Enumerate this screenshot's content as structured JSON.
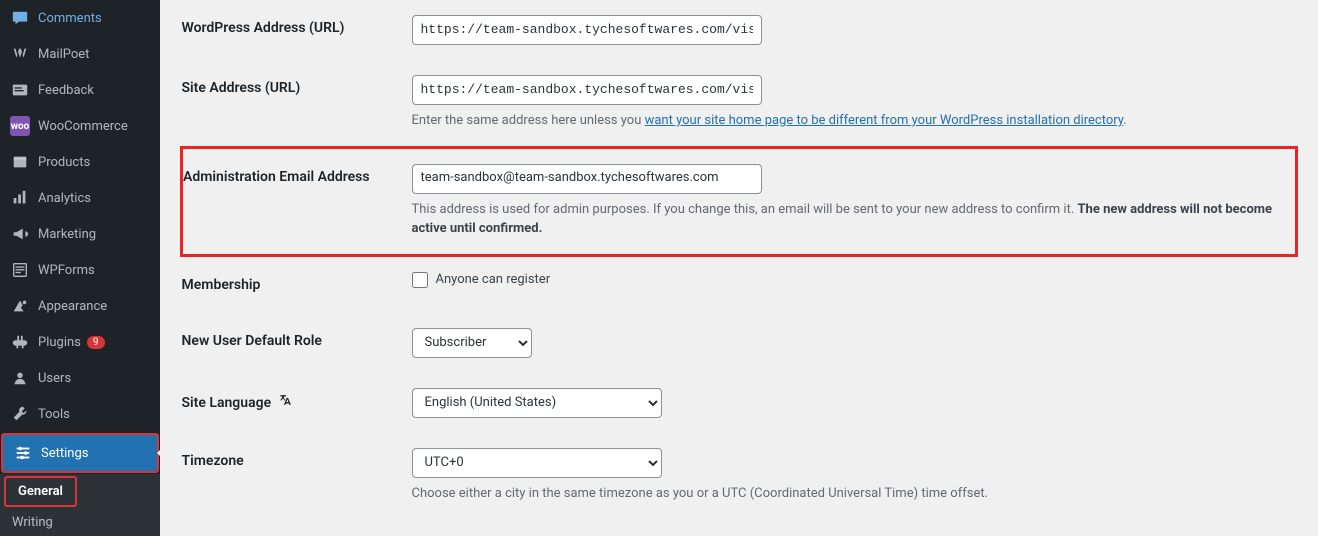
{
  "sidebar": {
    "items": [
      {
        "label": "Comments"
      },
      {
        "label": "MailPoet"
      },
      {
        "label": "Feedback"
      },
      {
        "label": "WooCommerce"
      },
      {
        "label": "Products"
      },
      {
        "label": "Analytics"
      },
      {
        "label": "Marketing"
      },
      {
        "label": "WPForms"
      },
      {
        "label": "Appearance"
      },
      {
        "label": "Plugins",
        "badge": "9"
      },
      {
        "label": "Users"
      },
      {
        "label": "Tools"
      },
      {
        "label": "Settings"
      }
    ],
    "sub": [
      {
        "label": "General"
      },
      {
        "label": "Writing"
      }
    ]
  },
  "settings": {
    "wp_address": {
      "label": "WordPress Address (URL)",
      "value": "https://team-sandbox.tychesoftwares.com/vis"
    },
    "site_address": {
      "label": "Site Address (URL)",
      "value": "https://team-sandbox.tychesoftwares.com/vis",
      "help_pre": "Enter the same address here unless you ",
      "help_link": "want your site home page to be different from your WordPress installation directory",
      "help_post": "."
    },
    "admin_email": {
      "label": "Administration Email Address",
      "value": "team-sandbox@team-sandbox.tychesoftwares.com",
      "help_pre": "This address is used for admin purposes. If you change this, an email will be sent to your new address to confirm it. ",
      "help_strong": "The new address will not become active until confirmed."
    },
    "membership": {
      "label": "Membership",
      "checkbox_label": "Anyone can register"
    },
    "new_user_role": {
      "label": "New User Default Role",
      "value": "Subscriber"
    },
    "site_language": {
      "label": "Site Language",
      "value": "English (United States)"
    },
    "timezone": {
      "label": "Timezone",
      "value": "UTC+0",
      "help": "Choose either a city in the same timezone as you or a UTC (Coordinated Universal Time) time offset."
    }
  }
}
